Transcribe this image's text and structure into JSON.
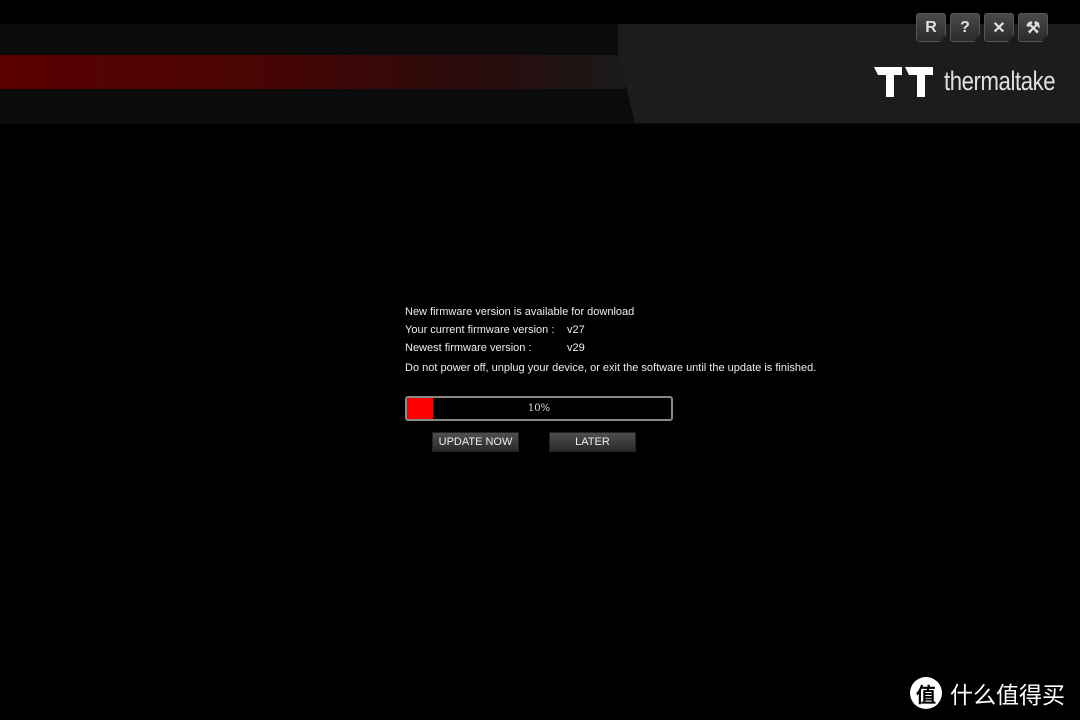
{
  "window_buttons": [
    {
      "label": "R",
      "name": "reset"
    },
    {
      "label": "?",
      "name": "help"
    },
    {
      "label": "✕",
      "name": "close"
    },
    {
      "label": "⚒",
      "name": "settings"
    }
  ],
  "brand": {
    "name": "thermaltake"
  },
  "firmware": {
    "headline": "New firmware version is available for download",
    "current_label": "Your current firmware version :",
    "current_value": "v27",
    "newest_label": "Newest firmware version :",
    "newest_value": "v29",
    "warning": "Do not power off, unplug your device, or exit the software until the update is finished.",
    "progress_percent": 10,
    "progress_text": "10%",
    "update_label": "UPDATE NOW",
    "later_label": "LATER"
  },
  "colors": {
    "accent": "#ff0000",
    "header_red": "#5a0000"
  },
  "watermark": {
    "icon_char": "值",
    "text": "什么值得买"
  }
}
